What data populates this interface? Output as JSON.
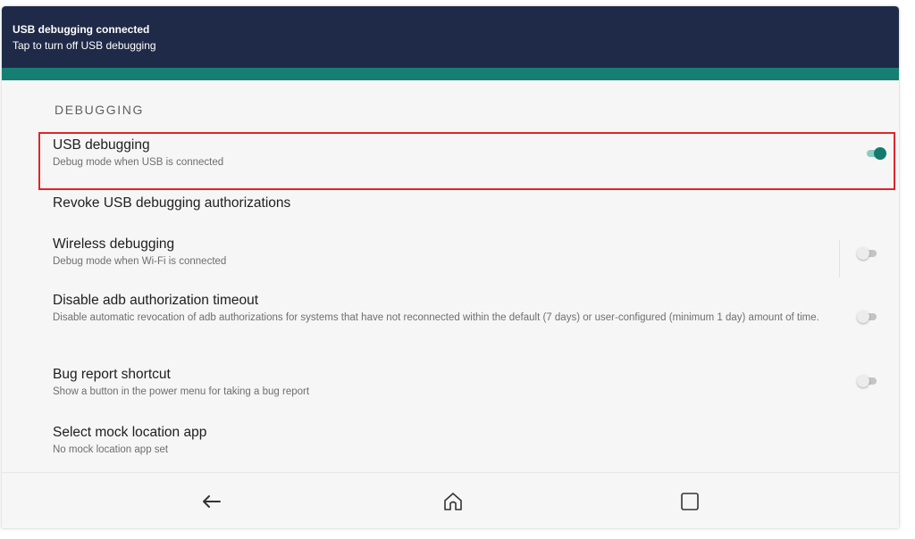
{
  "notification": {
    "title": "USB debugging connected",
    "subtitle": "Tap to turn off USB debugging"
  },
  "section": {
    "header": "DEBUGGING"
  },
  "preferences": [
    {
      "title": "USB debugging",
      "summary": "Debug mode when USB is connected",
      "toggle": "on"
    },
    {
      "title": "Revoke USB debugging authorizations",
      "summary": ""
    },
    {
      "title": "Wireless debugging",
      "summary": "Debug mode when Wi-Fi is connected",
      "toggle": "off"
    },
    {
      "title": "Disable adb authorization timeout",
      "summary": "Disable automatic revocation of adb authorizations for systems that have not reconnected within the default (7 days) or user-configured (minimum 1 day) amount of time.",
      "toggle": "off"
    },
    {
      "title": "Bug report shortcut",
      "summary": "Show a button in the power menu for taking a bug report",
      "toggle": "off"
    },
    {
      "title": "Select mock location app",
      "summary": "No mock location app set"
    }
  ],
  "navbar": {
    "back": "back-arrow-icon",
    "home": "home-icon",
    "recents": "recents-square-icon"
  },
  "colors": {
    "notification_bg": "#1f2a48",
    "accent_teal": "#167f73",
    "highlight_red": "#e0242c",
    "switch_on": "#137a6d"
  }
}
